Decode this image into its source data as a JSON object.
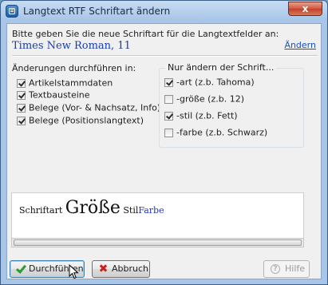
{
  "window": {
    "title": "Langtext RTF Schriftart ändern",
    "close_label": "x",
    "icon": "app-icon"
  },
  "font_section": {
    "prompt": "Bitte geben Sie die neue Schriftart für die Langtextfelder an:",
    "current_font": "Times New Roman, 11",
    "change_link": "Ändern"
  },
  "apply_to": {
    "label": "Änderungen durchführen in:",
    "items": [
      {
        "label": "Artikelstammdaten",
        "checked": true
      },
      {
        "label": "Textbausteine",
        "checked": true
      },
      {
        "label": "Belege (Vor- & Nachsatz, Info)",
        "checked": true
      },
      {
        "label": "Belege (Positionslangtext)",
        "checked": true
      }
    ]
  },
  "change_only": {
    "label": "Nur ändern der Schrift...",
    "items": [
      {
        "label": "-art (z.b. Tahoma)",
        "checked": true
      },
      {
        "label": "-größe (z.b. 12)",
        "checked": false
      },
      {
        "label": "-stil (z.b. Fett)",
        "checked": true
      },
      {
        "label": "-farbe (z.b. Schwarz)",
        "checked": false
      }
    ]
  },
  "preview": {
    "art": "Schriftart",
    "size": "Größe",
    "stil": "Stil",
    "farbe": "Farbe",
    "farbe_color": "#1a37c8"
  },
  "buttons": {
    "execute": "Durchführen",
    "cancel": "Abbruch",
    "help": "Hilfe"
  },
  "colors": {
    "titlebar": "#a9c6e8",
    "link": "#1a4fc4",
    "font_name": "#1a3ca8",
    "close_button": "#c4402a"
  }
}
